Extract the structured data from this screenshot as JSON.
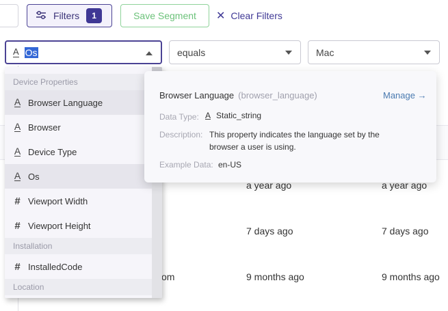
{
  "toolbar": {
    "filters_label": "Filters",
    "filters_count": "1",
    "save_segment_label": "Save Segment",
    "clear_filters_label": "Clear Filters"
  },
  "filter": {
    "property_value": "Os",
    "operator_value": "equals",
    "value_value": "Mac"
  },
  "dropdown": {
    "sections": [
      "Device Properties",
      "Installation",
      "Location"
    ],
    "items": [
      {
        "label": "Browser Language",
        "icon": "text-type-icon"
      },
      {
        "label": "Browser",
        "icon": "text-type-icon"
      },
      {
        "label": "Device Type",
        "icon": "text-type-icon"
      },
      {
        "label": "Os",
        "icon": "text-type-icon"
      },
      {
        "label": "Viewport Width",
        "icon": "number-type-icon"
      },
      {
        "label": "Viewport Height",
        "icon": "number-type-icon"
      },
      {
        "label": "InstalledCode",
        "icon": "number-type-icon"
      }
    ]
  },
  "tooltip": {
    "name": "Browser Language",
    "key": "(browser_language)",
    "manage_label": "Manage →",
    "data_type_label": "Data Type:",
    "data_type_value": "Static_string",
    "description_label": "Description:",
    "description_value": "This property indicates the language set by the browser a user is using.",
    "example_label": "Example Data:",
    "example_value": "en-US"
  },
  "table": {
    "rows": [
      {
        "c1": "",
        "c2": "a year ago",
        "c3": "a year ago"
      },
      {
        "c1": "",
        "c2": "7 days ago",
        "c3": "7 days ago"
      },
      {
        "c1": "om",
        "c2": "9 months ago",
        "c3": "9 months ago"
      }
    ]
  },
  "colors": {
    "brand_primary": "#3f3895",
    "save_green": "#6cc27a",
    "link_blue": "#4a7ab0",
    "selection_blue": "#3367d6"
  }
}
